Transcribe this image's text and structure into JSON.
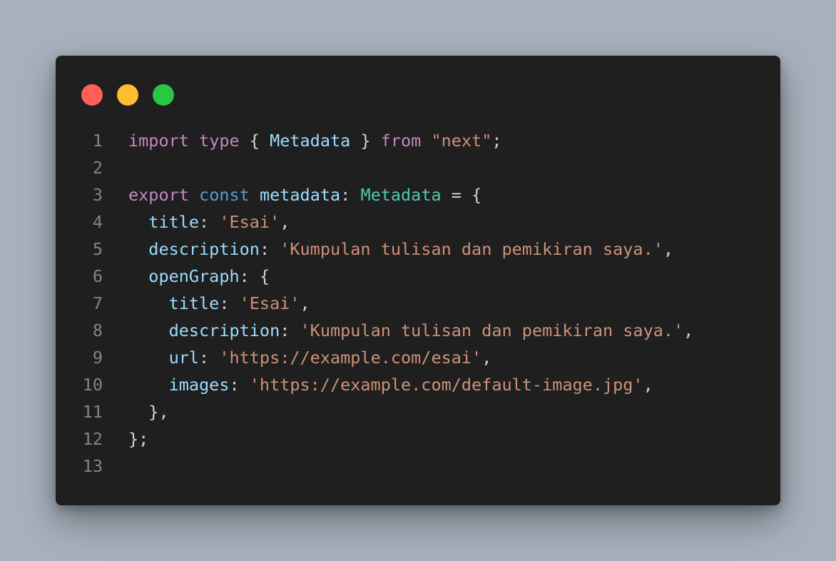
{
  "window": {
    "controls": [
      {
        "name": "close",
        "color": "#ff5f57"
      },
      {
        "name": "minimize",
        "color": "#febc2e"
      },
      {
        "name": "maximize",
        "color": "#28c840"
      }
    ]
  },
  "theme": {
    "keyword": "#c586c0",
    "storage": "#569cd6",
    "variable": "#9cdcfe",
    "type": "#4ec9b0",
    "string": "#ce9178",
    "punctuation": "#d4d4d4",
    "line_number": "#858585",
    "background": "#1f1f1f"
  },
  "code": {
    "lines": [
      {
        "number": "1",
        "tokens": [
          {
            "t": "import",
            "k": "keyword"
          },
          {
            "t": " ",
            "k": "punctuation"
          },
          {
            "t": "type",
            "k": "keyword"
          },
          {
            "t": " { ",
            "k": "punctuation"
          },
          {
            "t": "Metadata",
            "k": "variable"
          },
          {
            "t": " } ",
            "k": "punctuation"
          },
          {
            "t": "from",
            "k": "keyword"
          },
          {
            "t": " ",
            "k": "punctuation"
          },
          {
            "t": "\"next\"",
            "k": "string"
          },
          {
            "t": ";",
            "k": "punctuation"
          }
        ]
      },
      {
        "number": "2",
        "tokens": []
      },
      {
        "number": "3",
        "tokens": [
          {
            "t": "export",
            "k": "keyword"
          },
          {
            "t": " ",
            "k": "punctuation"
          },
          {
            "t": "const",
            "k": "storage"
          },
          {
            "t": " ",
            "k": "punctuation"
          },
          {
            "t": "metadata",
            "k": "variable"
          },
          {
            "t": ": ",
            "k": "punctuation"
          },
          {
            "t": "Metadata",
            "k": "type"
          },
          {
            "t": " = {",
            "k": "punctuation"
          }
        ]
      },
      {
        "number": "4",
        "tokens": [
          {
            "t": "  ",
            "k": "punctuation"
          },
          {
            "t": "title",
            "k": "variable"
          },
          {
            "t": ": ",
            "k": "punctuation"
          },
          {
            "t": "'Esai'",
            "k": "string"
          },
          {
            "t": ",",
            "k": "punctuation"
          }
        ]
      },
      {
        "number": "5",
        "tokens": [
          {
            "t": "  ",
            "k": "punctuation"
          },
          {
            "t": "description",
            "k": "variable"
          },
          {
            "t": ": ",
            "k": "punctuation"
          },
          {
            "t": "'Kumpulan tulisan dan pemikiran saya.'",
            "k": "string"
          },
          {
            "t": ",",
            "k": "punctuation"
          }
        ]
      },
      {
        "number": "6",
        "tokens": [
          {
            "t": "  ",
            "k": "punctuation"
          },
          {
            "t": "openGraph",
            "k": "variable"
          },
          {
            "t": ": {",
            "k": "punctuation"
          }
        ]
      },
      {
        "number": "7",
        "tokens": [
          {
            "t": "    ",
            "k": "punctuation"
          },
          {
            "t": "title",
            "k": "variable"
          },
          {
            "t": ": ",
            "k": "punctuation"
          },
          {
            "t": "'Esai'",
            "k": "string"
          },
          {
            "t": ",",
            "k": "punctuation"
          }
        ]
      },
      {
        "number": "8",
        "tokens": [
          {
            "t": "    ",
            "k": "punctuation"
          },
          {
            "t": "description",
            "k": "variable"
          },
          {
            "t": ": ",
            "k": "punctuation"
          },
          {
            "t": "'Kumpulan tulisan dan pemikiran saya.'",
            "k": "string"
          },
          {
            "t": ",",
            "k": "punctuation"
          }
        ]
      },
      {
        "number": "9",
        "tokens": [
          {
            "t": "    ",
            "k": "punctuation"
          },
          {
            "t": "url",
            "k": "variable"
          },
          {
            "t": ": ",
            "k": "punctuation"
          },
          {
            "t": "'https://example.com/esai'",
            "k": "string"
          },
          {
            "t": ",",
            "k": "punctuation"
          }
        ]
      },
      {
        "number": "10",
        "tokens": [
          {
            "t": "    ",
            "k": "punctuation"
          },
          {
            "t": "images",
            "k": "variable"
          },
          {
            "t": ": ",
            "k": "punctuation"
          },
          {
            "t": "'https://example.com/default-image.jpg'",
            "k": "string"
          },
          {
            "t": ",",
            "k": "punctuation"
          }
        ]
      },
      {
        "number": "11",
        "tokens": [
          {
            "t": "  },",
            "k": "punctuation"
          }
        ]
      },
      {
        "number": "12",
        "tokens": [
          {
            "t": "};",
            "k": "punctuation"
          }
        ]
      },
      {
        "number": "13",
        "tokens": []
      }
    ]
  }
}
